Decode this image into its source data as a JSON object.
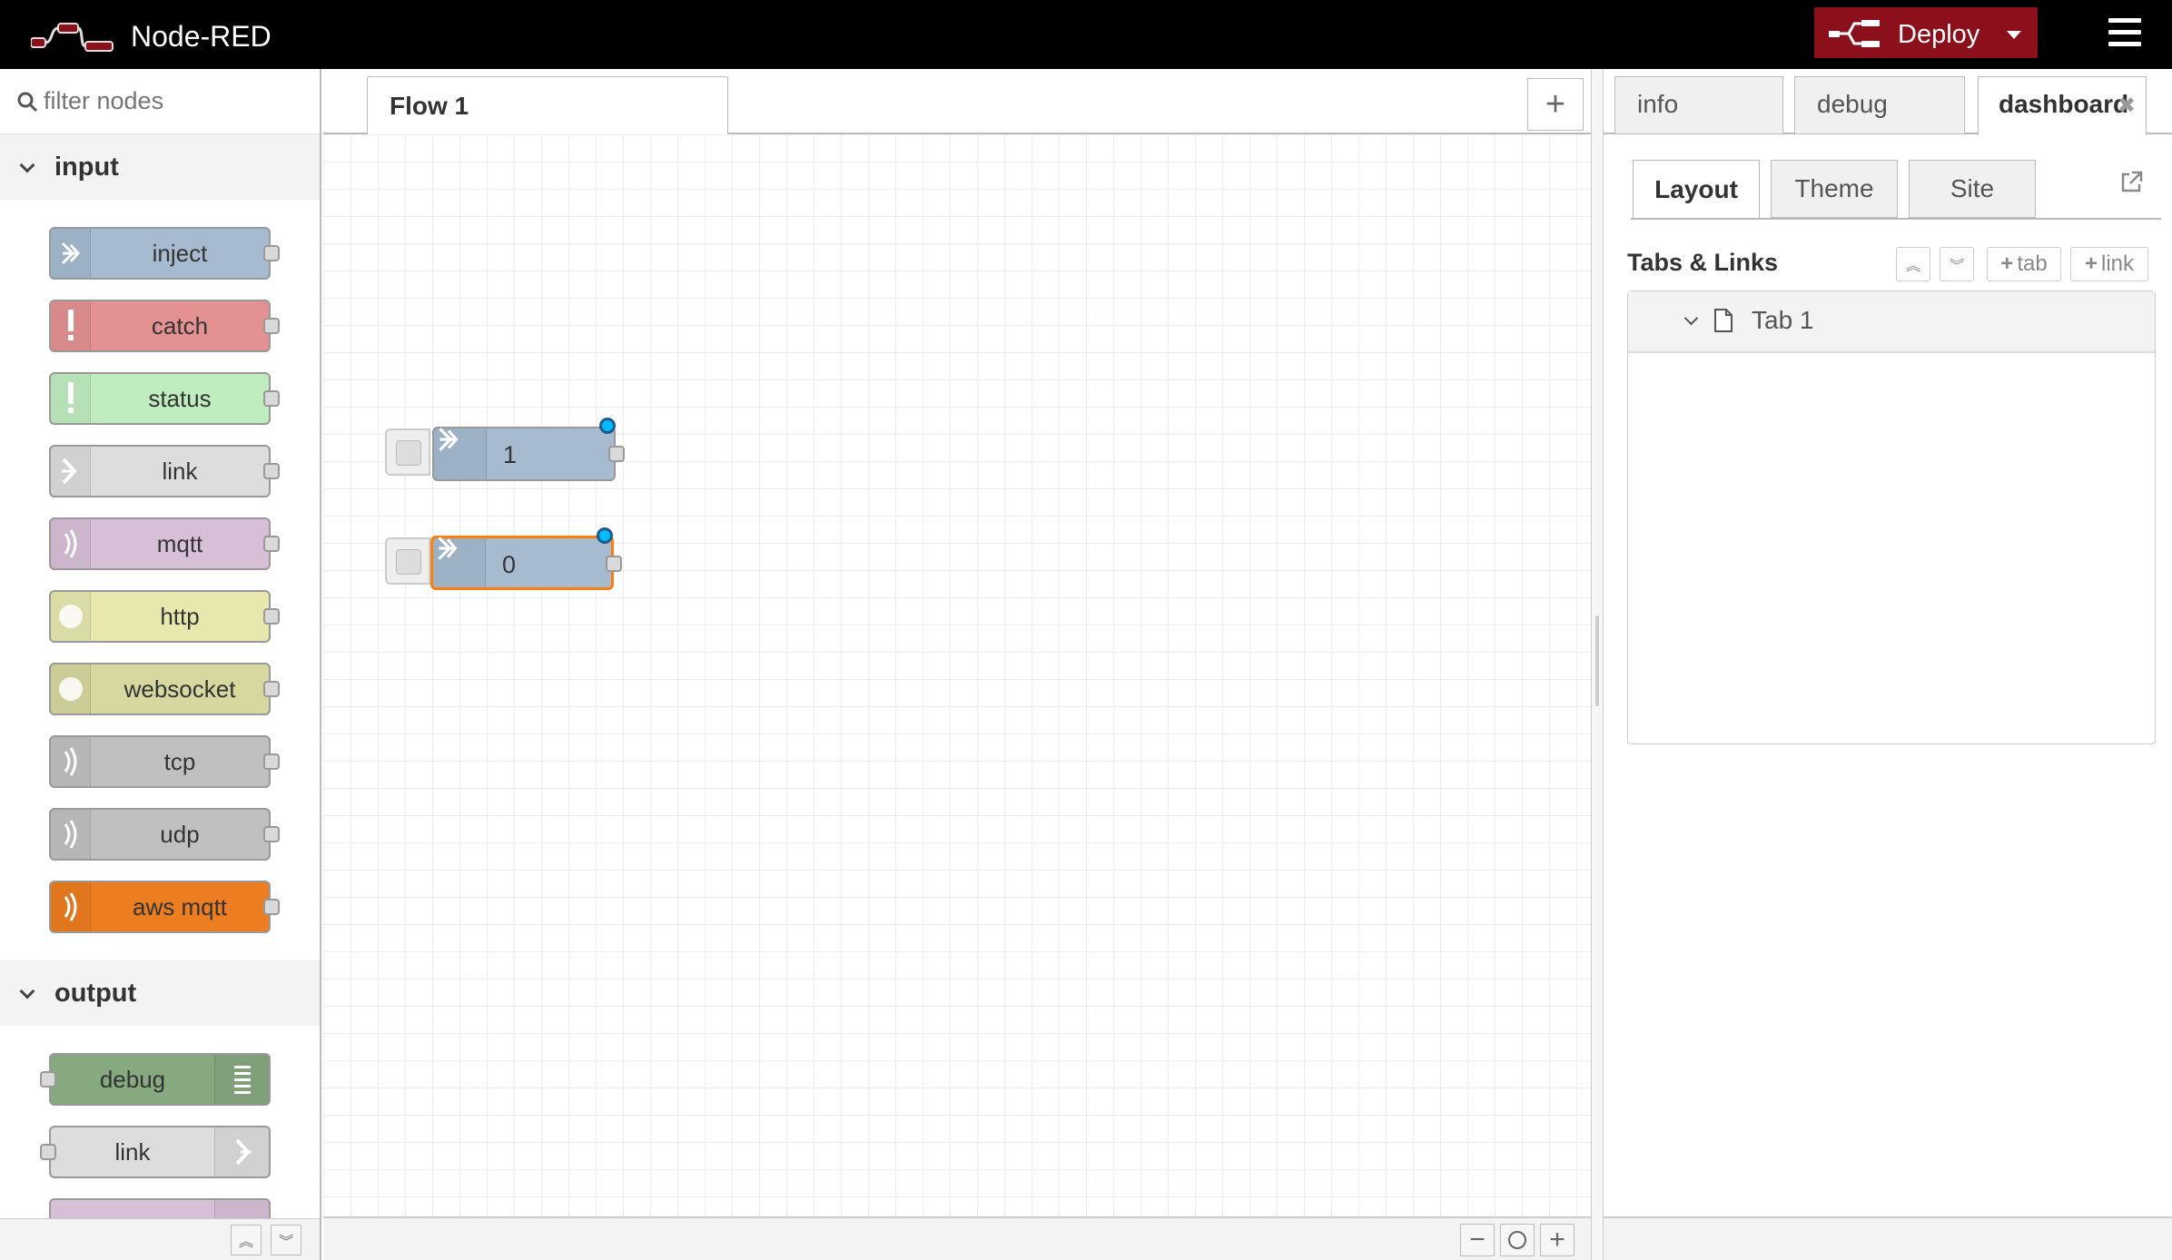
{
  "app": {
    "title": "Node-RED",
    "deploy_label": "Deploy",
    "colors": {
      "header_bg": "#000000",
      "deploy_bg": "#8c101c",
      "selection": "#ff7f0e",
      "changed": "#00bcff"
    }
  },
  "palette": {
    "search_placeholder": "filter nodes",
    "categories": [
      {
        "label": "input",
        "nodes": [
          {
            "label": "inject",
            "color": "#a6bbcf",
            "icon": "arrow-in-icon"
          },
          {
            "label": "catch",
            "color": "#e49191",
            "icon": "alert-icon"
          },
          {
            "label": "status",
            "color": "#c0edc0",
            "icon": "alert-icon"
          },
          {
            "label": "link",
            "color": "#dddddd",
            "icon": "link-in-icon"
          },
          {
            "label": "mqtt",
            "color": "#d8bfd8",
            "icon": "bridge-icon"
          },
          {
            "label": "http",
            "color": "#e7e7ae",
            "icon": "globe-icon"
          },
          {
            "label": "websocket",
            "color": "#d7d7a0",
            "icon": "globe-icon"
          },
          {
            "label": "tcp",
            "color": "#c0c0c0",
            "icon": "bridge-icon"
          },
          {
            "label": "udp",
            "color": "#c0c0c0",
            "icon": "bridge-icon"
          },
          {
            "label": "aws mqtt",
            "color": "#ec7e21",
            "icon": "bridge-icon"
          }
        ]
      },
      {
        "label": "output",
        "nodes": [
          {
            "label": "debug",
            "color": "#87a980",
            "icon": "list-icon"
          },
          {
            "label": "link",
            "color": "#dddddd",
            "icon": "link-out-icon"
          }
        ]
      }
    ]
  },
  "workspace": {
    "tabs": [
      {
        "label": "Flow 1"
      }
    ],
    "nodes": [
      {
        "label": "1",
        "selected": false
      },
      {
        "label": "0",
        "selected": true
      }
    ]
  },
  "sidebar": {
    "tabs": [
      {
        "label": "info"
      },
      {
        "label": "debug"
      },
      {
        "label": "dashboard"
      }
    ],
    "dashboard": {
      "sub_tabs": [
        {
          "label": "Layout"
        },
        {
          "label": "Theme"
        },
        {
          "label": "Site"
        }
      ],
      "section_title": "Tabs & Links",
      "buttons": {
        "add_tab": "tab",
        "add_link": "link"
      },
      "items": [
        {
          "label": "Tab 1"
        }
      ]
    }
  }
}
